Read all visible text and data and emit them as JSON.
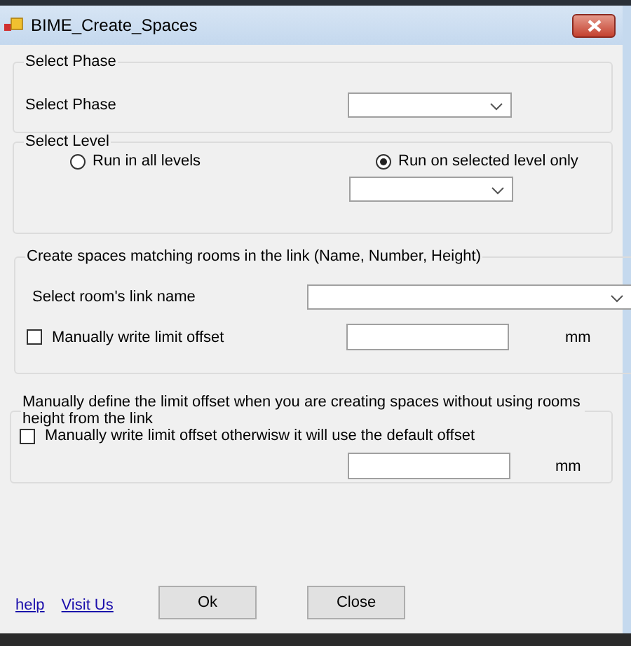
{
  "window": {
    "title": "BIME_Create_Spaces"
  },
  "phase_group": {
    "title": "Select Phase",
    "label": "Select Phase"
  },
  "level_group": {
    "title": "Select Level",
    "options": [
      {
        "label": "Run in all levels",
        "selected": false
      },
      {
        "label": "Run on selected level only",
        "selected": true
      }
    ]
  },
  "rooms_group": {
    "title": "Create spaces matching rooms in the link (Name, Number, Height)",
    "link_label": "Select room's link name",
    "offset_checkbox": {
      "label": "Manually write limit offset",
      "checked": false
    },
    "unit": "mm"
  },
  "manual_group": {
    "title": "Manually define the limit offset when you are creating spaces without using rooms height from the link",
    "checkbox": {
      "label": "Manually write limit offset otherwisw it will use the default offset",
      "checked": false
    },
    "unit": "mm"
  },
  "buttons": [
    "Ok",
    "Close"
  ],
  "links": [
    "help",
    "Visit Us"
  ]
}
